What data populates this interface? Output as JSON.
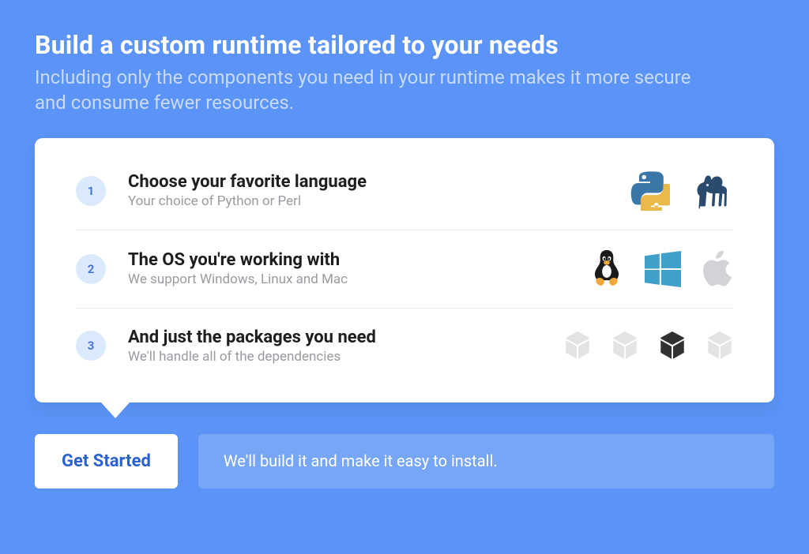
{
  "hero": {
    "title": "Build a custom runtime tailored to your needs",
    "subtitle": "Including only the components you need in your runtime makes it more secure and consume fewer resources."
  },
  "steps": [
    {
      "num": "1",
      "title": "Choose your favorite language",
      "sub": "Your choice of Python or Perl"
    },
    {
      "num": "2",
      "title": "The OS you're working with",
      "sub": "We support Windows, Linux and Mac"
    },
    {
      "num": "3",
      "title": "And just the packages you need",
      "sub": "We'll handle all of the dependencies"
    }
  ],
  "cta": {
    "button": "Get Started",
    "note": "We'll build it and make it easy to install."
  },
  "colors": {
    "bg": "#5b93f6",
    "accent": "#2a60cf"
  }
}
